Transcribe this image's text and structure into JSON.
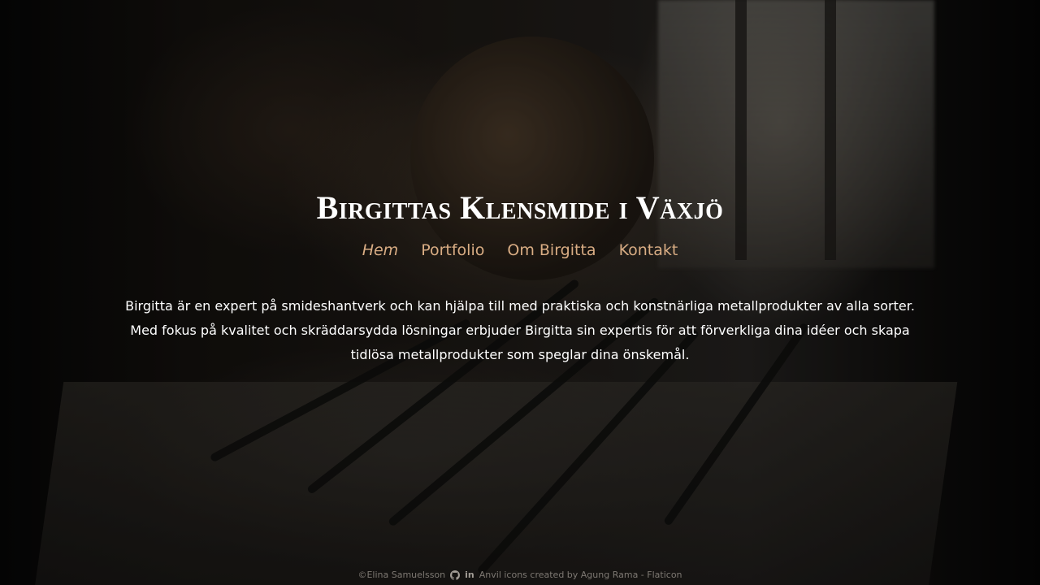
{
  "site": {
    "title": "Birgittas Klensmide i Växjö"
  },
  "nav": {
    "items": [
      {
        "label": "Hem",
        "active": true
      },
      {
        "label": "Portfolio",
        "active": false
      },
      {
        "label": "Om Birgitta",
        "active": false
      },
      {
        "label": "Kontakt",
        "active": false
      }
    ]
  },
  "intro": {
    "text": "Birgitta är en expert på smideshantverk och kan hjälpa till med praktiska och konstnärliga metallprodukter av alla sorter. Med fokus på kvalitet och skräddarsydda lösningar erbjuder Birgitta sin expertis för att förverkliga dina idéer och skapa tidlösa metallprodukter som speglar dina önskemål."
  },
  "footer": {
    "copyright": "©Elina Samuelsson",
    "icons": [
      "github-icon",
      "linkedin-icon"
    ],
    "linkedin_glyph": "in",
    "credits": "Anvil icons created by Agung Rama - Flaticon"
  },
  "colors": {
    "nav_link": "#d9ad84",
    "text": "#ffffff",
    "footer_text": "#7d7872"
  }
}
